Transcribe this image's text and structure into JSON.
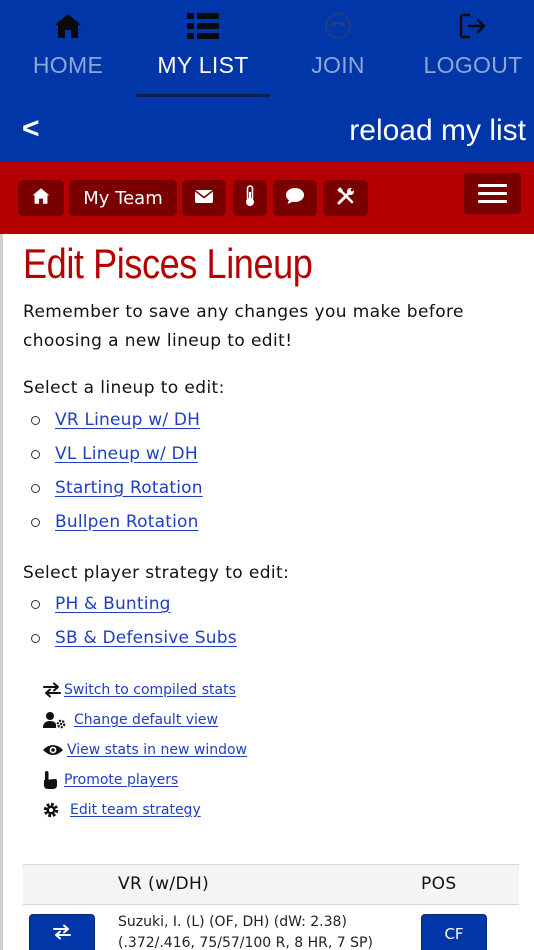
{
  "topnav": {
    "items": [
      {
        "label": "HOME",
        "icon": "home-icon",
        "active": false
      },
      {
        "label": "MY LIST",
        "icon": "list-icon",
        "active": true
      },
      {
        "label": "JOIN",
        "icon": "join-icon",
        "active": false
      },
      {
        "label": "LOGOUT",
        "icon": "logout-icon",
        "active": false
      }
    ],
    "back_label": "<",
    "reload_label": "reload my list"
  },
  "redbar": {
    "buttons": [
      {
        "label": "",
        "icon": "home-icon"
      },
      {
        "label": "My Team",
        "icon": ""
      },
      {
        "label": "",
        "icon": "envelope-icon"
      },
      {
        "label": "",
        "icon": "thermometer-icon"
      },
      {
        "label": "",
        "icon": "comment-icon"
      },
      {
        "label": "",
        "icon": "tools-icon"
      }
    ],
    "menu_icon": "hamburger-icon"
  },
  "page": {
    "title": "Edit Pisces Lineup",
    "intro": "Remember to save any changes you make before choosing a new lineup to edit!",
    "lineup_heading": "Select a lineup to edit:",
    "lineups": [
      "VR Lineup w/ DH",
      "VL Lineup w/ DH",
      "Starting Rotation",
      "Bullpen Rotation"
    ],
    "strategy_heading": "Select player strategy to edit:",
    "strategies": [
      "PH & Bunting",
      "SB & Defensive Subs"
    ],
    "tools": [
      {
        "label": "Switch to compiled stats",
        "icon": "swap-icon"
      },
      {
        "label": "Change default view",
        "icon": "user-cog-icon"
      },
      {
        "label": "View stats in new window",
        "icon": "eye-icon"
      },
      {
        "label": "Promote players",
        "icon": "pointer-hand-icon"
      },
      {
        "label": "Edit team strategy",
        "icon": "gear-icon"
      }
    ]
  },
  "table": {
    "col_lineup": "VR (w/DH)",
    "col_pos": "POS",
    "rows": [
      {
        "player_line1": "Suzuki, I. (L) (OF, DH) (dW: 2.38)",
        "player_line2": "(.372/.416, 75/57/100 R, 8 HR, 7 SP)",
        "pos": "CF"
      }
    ]
  },
  "colors": {
    "nav_blue": "#0036a8",
    "bar_red": "#b40000",
    "btn_dark_red": "#7a0000",
    "title_red": "#b40000",
    "link_blue": "#1f3fbf"
  }
}
